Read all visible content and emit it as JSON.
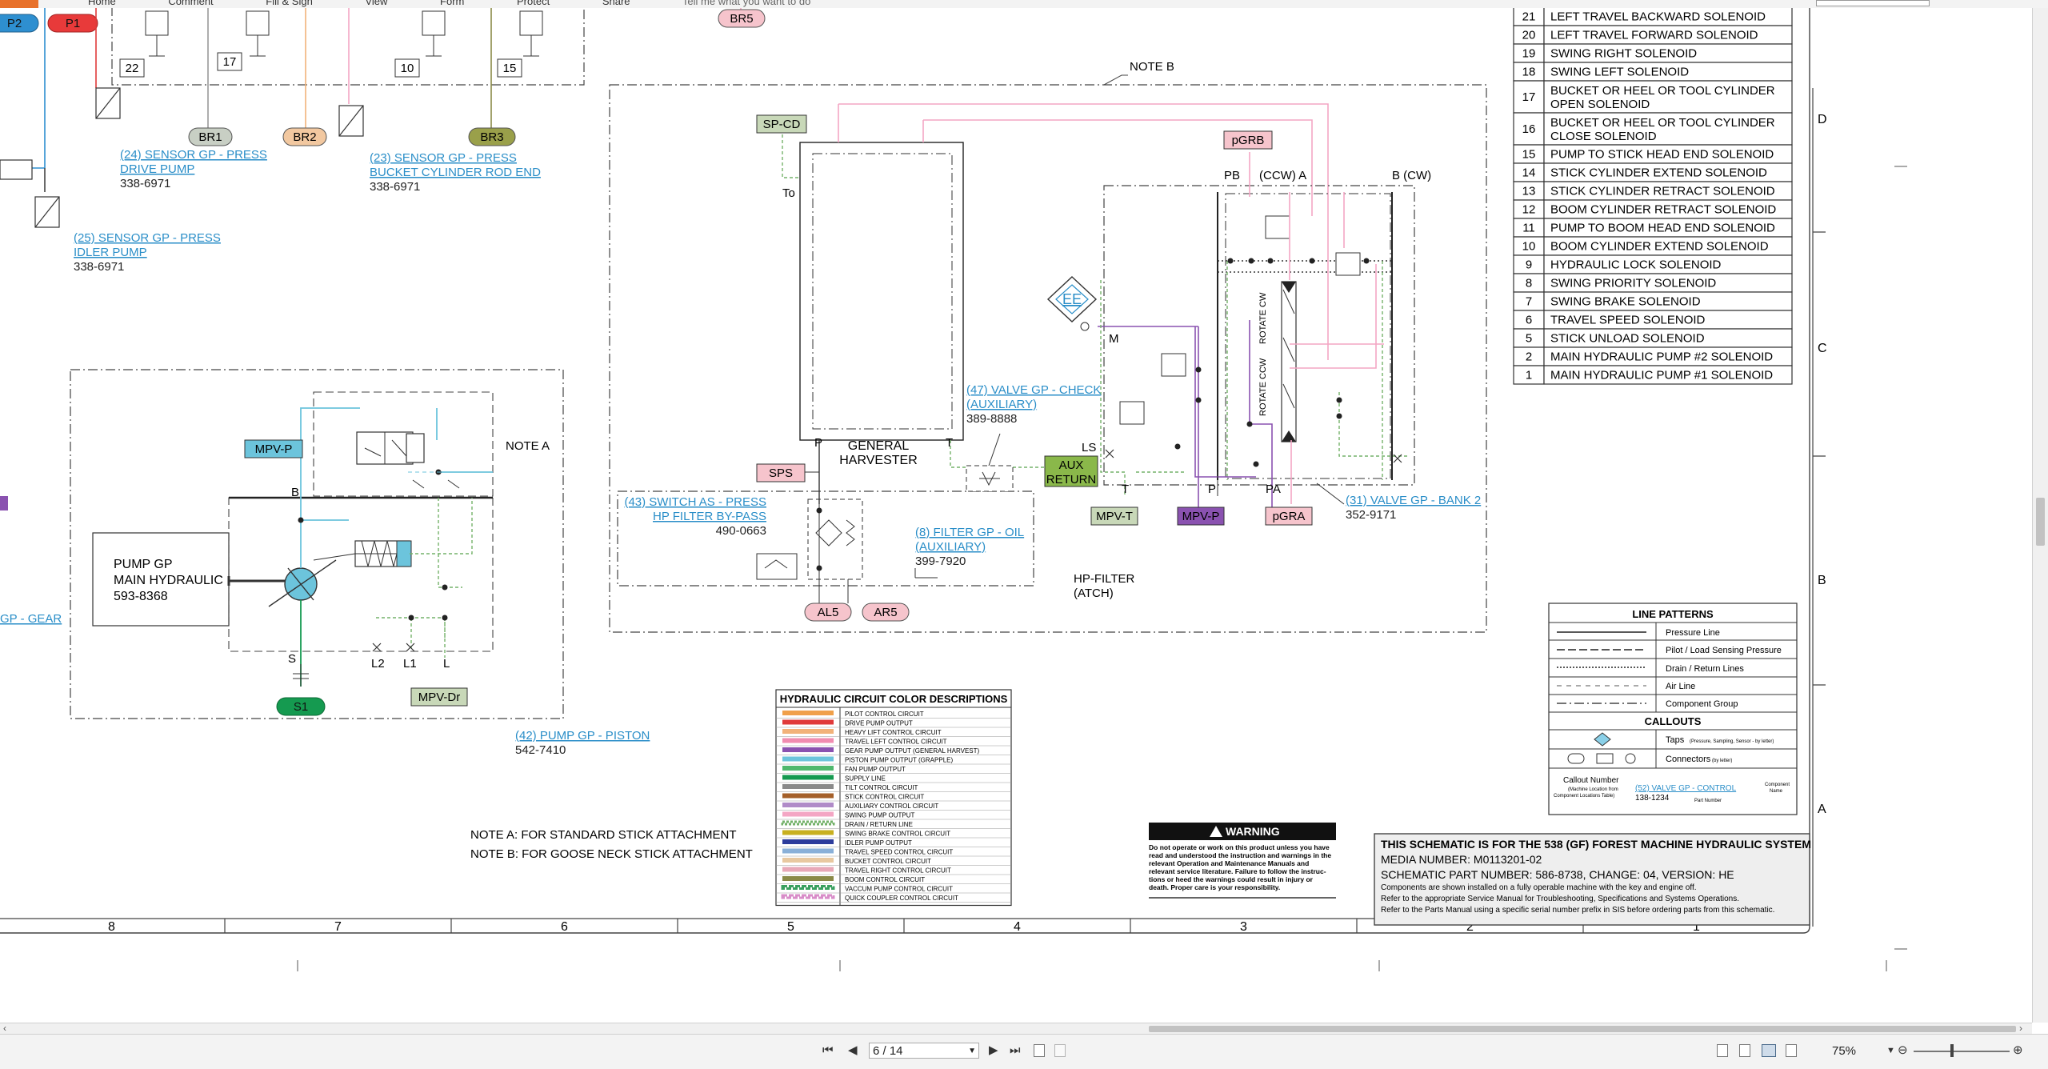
{
  "app": {
    "menu": [
      "Home",
      "Comment",
      "Fill & Sign",
      "View",
      "Form",
      "Protect",
      "Share"
    ],
    "search_placeholder": "Tell me what you want to do"
  },
  "status": {
    "page_value": "6 / 14",
    "zoom": "75%"
  },
  "schematic": {
    "top_connectors": [
      "P2",
      "P1"
    ],
    "top_tags": [
      "22",
      "17",
      "10",
      "15"
    ],
    "br_tags": [
      "BR1",
      "BR2",
      "BR3",
      "BR5"
    ],
    "sensors": [
      {
        "name": "(24) SENSOR GP - PRESS",
        "name2": "DRIVE PUMP",
        "part": "338-6971"
      },
      {
        "name": "(23) SENSOR GP - PRESS",
        "name2": "BUCKET CYLINDER ROD END",
        "part": "338-6971"
      },
      {
        "name": "(25) SENSOR GP - PRESS",
        "name2": "IDLER PUMP",
        "part": "338-6971"
      }
    ],
    "gear_link": "GP - GEAR",
    "pump": {
      "title1": "PUMP GP",
      "title2": "MAIN HYDRAULIC",
      "part": "593-8368",
      "mpv_p": "MPV-P",
      "mpv_dr": "MPV-Dr",
      "s1": "S1",
      "b": "B",
      "s": "S",
      "l2": "L2",
      "l1": "L1",
      "l": "L",
      "note_a": "NOTE A",
      "link": "(42) PUMP GP - PISTON",
      "link_part": "542-7410"
    },
    "notes": {
      "note_b": "NOTE B",
      "a": "NOTE A: FOR STANDARD STICK ATTACHMENT",
      "b": "NOTE B: FOR GOOSE NECK STICK ATTACHMENT"
    },
    "harvester": {
      "sp_cd": "SP-CD",
      "to": "To",
      "p": "P",
      "t": "T",
      "label1": "GENERAL",
      "label2": "HARVESTER",
      "sps": "SPS",
      "check_valve": "(47) VALVE GP - CHECK",
      "check_valve2": "(AUXILIARY)",
      "check_part": "389-8888",
      "aux_return1": "AUX",
      "aux_return2": "RETURN",
      "switch": "(43) SWITCH AS - PRESS",
      "switch2": "HP FILTER BY-PASS",
      "switch_part": "490-0663",
      "filter": "(8) FILTER GP - OIL",
      "filter2": "(AUXILIARY)",
      "filter_part": "399-7920",
      "hp_filter": "HP-FILTER",
      "hp_filter2": "(ATCH)",
      "al5": "AL5",
      "ar5": "AR5"
    },
    "bank": {
      "pgrb": "pGRB",
      "pb": "PB",
      "ccw_a": "(CCW) A",
      "b_cw": "B (CW)",
      "ee": "EE",
      "m": "M",
      "ls": "LS",
      "t": "T",
      "p": "P",
      "pa": "PA",
      "rotate_cw": "ROTATE CW",
      "rotate_ccw": "ROTATE CCW",
      "mpv_t": "MPV-T",
      "mpv_p": "MPV-P",
      "pgra": "pGRA",
      "link": "(31) VALVE GP - BANK 2",
      "part": "352-9171"
    },
    "solenoids": [
      {
        "num": "21",
        "label": "LEFT TRAVEL BACKWARD SOLENOID"
      },
      {
        "num": "20",
        "label": "LEFT TRAVEL FORWARD SOLENOID"
      },
      {
        "num": "19",
        "label": "SWING RIGHT SOLENOID"
      },
      {
        "num": "18",
        "label": "SWING LEFT SOLENOID"
      },
      {
        "num": "17",
        "label": "BUCKET OR HEEL OR TOOL CYLINDER",
        "label2": "OPEN SOLENOID"
      },
      {
        "num": "16",
        "label": "BUCKET OR HEEL OR TOOL CYLINDER",
        "label2": "CLOSE SOLENOID"
      },
      {
        "num": "15",
        "label": "PUMP TO STICK HEAD END SOLENOID"
      },
      {
        "num": "14",
        "label": "STICK CYLINDER EXTEND SOLENOID"
      },
      {
        "num": "13",
        "label": "STICK CYLINDER RETRACT SOLENOID"
      },
      {
        "num": "12",
        "label": "BOOM CYLINDER RETRACT SOLENOID"
      },
      {
        "num": "11",
        "label": "PUMP TO BOOM HEAD END SOLENOID"
      },
      {
        "num": "10",
        "label": "BOOM CYLINDER EXTEND SOLENOID"
      },
      {
        "num": "9",
        "label": "HYDRAULIC LOCK SOLENOID"
      },
      {
        "num": "8",
        "label": "SWING PRIORITY SOLENOID"
      },
      {
        "num": "7",
        "label": "SWING BRAKE SOLENOID"
      },
      {
        "num": "6",
        "label": "TRAVEL SPEED SOLENOID"
      },
      {
        "num": "5",
        "label": "STICK UNLOAD SOLENOID"
      },
      {
        "num": "2",
        "label": "MAIN HYDRAULIC PUMP #2 SOLENOID"
      },
      {
        "num": "1",
        "label": "MAIN HYDRAULIC PUMP #1 SOLENOID"
      }
    ],
    "zone_letters": [
      "D",
      "C",
      "B",
      "A"
    ],
    "columns": [
      "8",
      "7",
      "6",
      "5",
      "4",
      "3",
      "2",
      "1"
    ],
    "color_legend": {
      "title": "HYDRAULIC CIRCUIT COLOR DESCRIPTIONS",
      "items": [
        {
          "color": "#f0a04a",
          "label": "PILOT CONTROL CIRCUIT"
        },
        {
          "color": "#e03a3a",
          "label": "DRIVE PUMP OUTPUT"
        },
        {
          "color": "#f2b27a",
          "label": "HEAVY LIFT CONTROL CIRCUIT"
        },
        {
          "color": "#f08cb0",
          "label": "TRAVEL LEFT CONTROL CIRCUIT"
        },
        {
          "color": "#8a52b0",
          "label": "GEAR PUMP OUTPUT (GENERAL HARVEST)"
        },
        {
          "color": "#6cc4dc",
          "label": "PISTON PUMP OUTPUT (GRAPPLE)"
        },
        {
          "color": "#4fb86e",
          "label": "FAN PUMP OUTPUT"
        },
        {
          "color": "#159a50",
          "label": "SUPPLY LINE"
        },
        {
          "color": "#8a8a8a",
          "label": "TILT CONTROL CIRCUIT"
        },
        {
          "color": "#a5602a",
          "label": "STICK CONTROL CIRCUIT"
        },
        {
          "color": "#b08bc8",
          "label": "AUXILIARY CONTROL CIRCUIT"
        },
        {
          "color": "#f4a6c4",
          "label": "SWING PUMP OUTPUT"
        },
        {
          "color": "#74b26a",
          "label": "DRAIN / RETURN LINE"
        },
        {
          "color": "#c8b020",
          "label": "SWING BRAKE CONTROL CIRCUIT"
        },
        {
          "color": "#2c3c9c",
          "label": "IDLER PUMP OUTPUT"
        },
        {
          "color": "#8ab0d8",
          "label": "TRAVEL SPEED CONTROL CIRCUIT"
        },
        {
          "color": "#e8c8a0",
          "label": "BUCKET CONTROL CIRCUIT"
        },
        {
          "color": "#e8a8b8",
          "label": "TRAVEL RIGHT CONTROL CIRCUIT"
        },
        {
          "color": "#8a8a48",
          "label": "BOOM CONTROL CIRCUIT"
        },
        {
          "color": "#3aa060",
          "label": "VACCUM PUMP CONTROL CIRCUIT"
        },
        {
          "color": "#d88cc8",
          "label": "QUICK COUPLER CONTROL CIRCUIT"
        }
      ]
    },
    "line_patterns": {
      "title": "LINE PATTERNS",
      "items": [
        "Pressure Line",
        "Pilot / Load Sensing Pressure",
        "Drain / Return Lines",
        "Air Line",
        "Component Group"
      ],
      "callouts_title": "CALLOUTS",
      "taps": "Taps",
      "taps_small": "(Pressure, Sampling, Sensor - by letter)",
      "connectors": "Connectors",
      "connectors_small": "(by letter)",
      "callout_number": "Callout Number",
      "callout_small1": "(Machine Location from",
      "callout_small2": "Component Locations Table)",
      "callout_link": "(52) VALVE GP - CONTROL",
      "callout_part": "138-1234",
      "component_name": "Component",
      "component_name2": "Name",
      "part_number": "Part Number"
    },
    "warning": {
      "title": "WARNING",
      "text": [
        "Do not operate or work on this product unless you have",
        "read and understood the instruction and warnings in the",
        "relevant Operation and Maintenance Manuals and",
        "relevant service literature. Failure to follow the instruc-",
        "tions or heed the warnings could result in injury or",
        "death. Proper care is your responsibility."
      ]
    },
    "title_block": {
      "line1": "THIS SCHEMATIC IS FOR THE 538 (GF) FOREST MACHINE HYDRAULIC SYSTEM",
      "line2": "MEDIA NUMBER: M0113201-02",
      "line3": "SCHEMATIC PART NUMBER: 586-8738, CHANGE: 04, VERSION: HE",
      "line4": "Components are shown installed on a fully operable machine with the key and engine off.",
      "line5": "Refer to the appropriate Service Manual for Troubleshooting, Specifications and Systems Operations.",
      "line6": "Refer to the Parts Manual using a specific serial number prefix in SIS before ordering parts from this schematic."
    }
  }
}
